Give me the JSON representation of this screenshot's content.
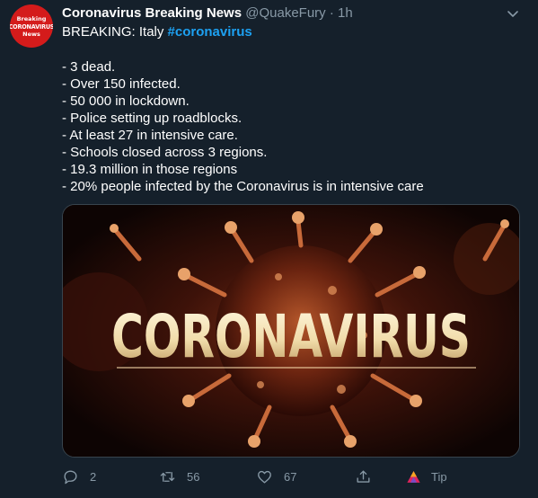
{
  "tweet": {
    "author_name": "Coronavirus Breaking News",
    "handle": "@QuakeFury",
    "separator": "·",
    "time": "1h",
    "avatar": {
      "line1": "Breaking",
      "line2": "CORONAVIRUS",
      "line3": "News",
      "color": "#d41b1b"
    },
    "headline_prefix": "BREAKING: Italy ",
    "hashtag": "#coronavirus",
    "bullets": [
      "- 3 dead.",
      "- Over 150 infected.",
      "- 50 000 in lockdown.",
      "- Police setting up roadblocks.",
      "- At least 27 in intensive care.",
      "- Schools closed across 3 regions.",
      "- 19.3 million in those regions",
      "- 20% people infected by the Coronavirus is in intensive care"
    ],
    "media_text": "CORONAVIRUS",
    "actions": {
      "reply_count": "2",
      "retweet_count": "56",
      "like_count": "67",
      "tip_label": "Tip"
    }
  },
  "colors": {
    "background": "#15202b",
    "text": "#ffffff",
    "secondary": "#8899a6",
    "link": "#1da1f2"
  },
  "icons": [
    "chevron-down-icon",
    "reply-icon",
    "retweet-icon",
    "like-icon",
    "share-icon",
    "tip-icon"
  ]
}
